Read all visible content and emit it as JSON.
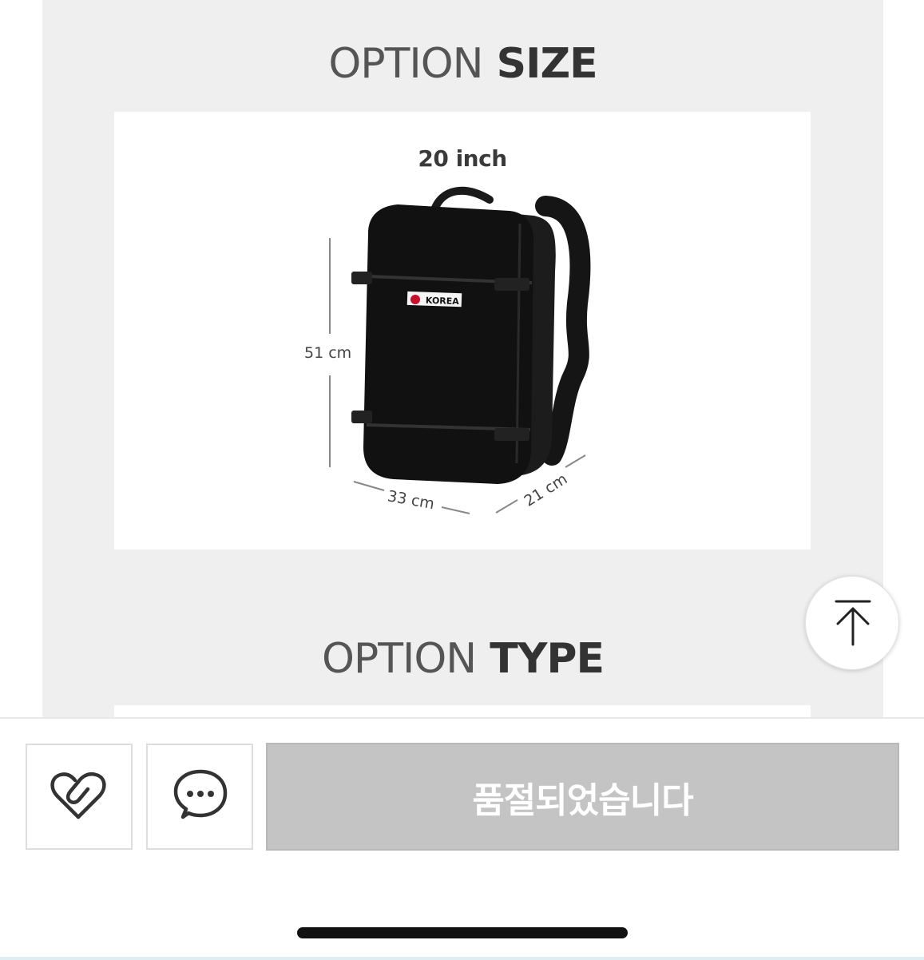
{
  "sections": {
    "size": {
      "title_light": "OPTION",
      "title_bold": "SIZE"
    },
    "type": {
      "title_light": "OPTION",
      "title_bold": "TYPE"
    }
  },
  "product_image": {
    "size_label": "20 inch",
    "height_label": "51 cm",
    "width_label": "33 cm",
    "depth_label": "21 cm",
    "patch_text": "KOREA"
  },
  "bottom_bar": {
    "like_icon": "heart-link-icon",
    "chat_icon": "chat-bubble-icon",
    "soldout_label": "품절되었습니다"
  },
  "scroll_top": {
    "icon": "arrow-up-to-top-icon"
  },
  "colors": {
    "panel_bg": "#efefef",
    "soldout_bg": "#c4c4c4",
    "backpack": "#111111"
  }
}
